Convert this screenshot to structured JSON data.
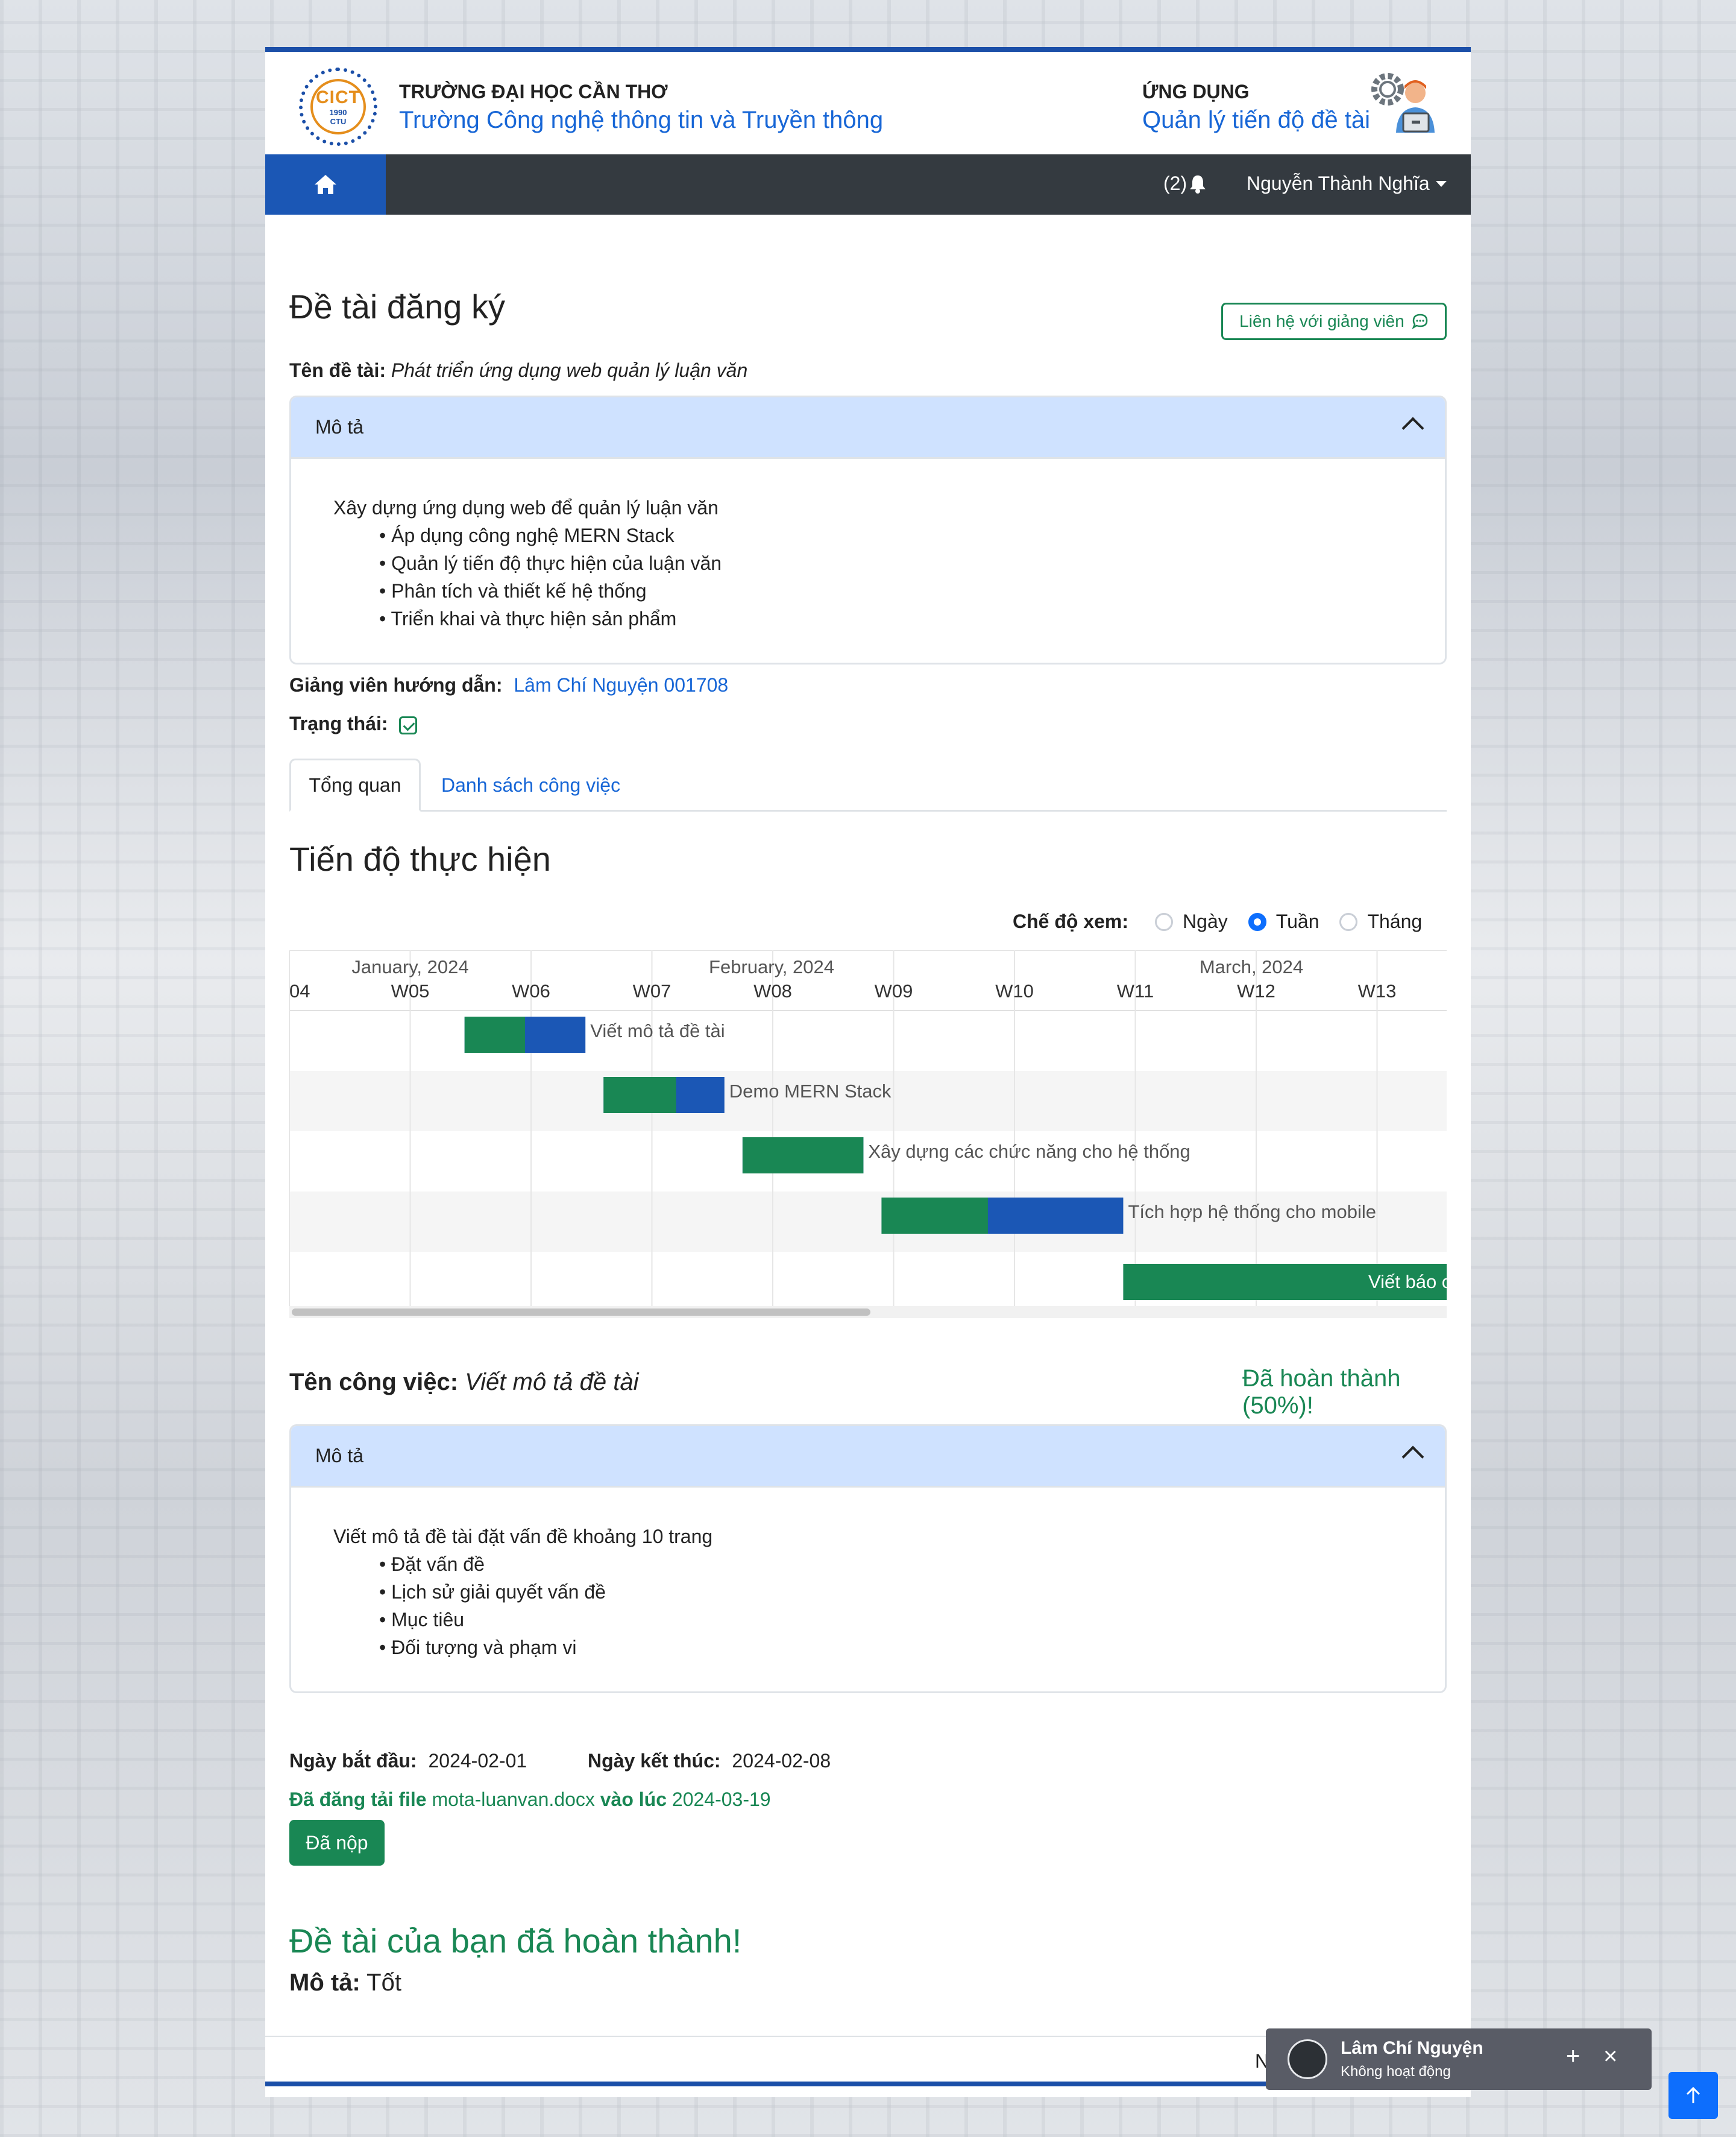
{
  "header": {
    "university": "TRƯỜNG ĐẠI HỌC CẦN THƠ",
    "school": "Trường Công nghệ thông tin và Truyền thông",
    "app_label": "ỨNG DỤNG",
    "app_name": "Quản lý tiến độ đề tài",
    "logo_text": "CICT",
    "logo_year": "1990",
    "logo_sub": "CTU"
  },
  "nav": {
    "notification_count": "(2)",
    "user_name": "Nguyễn Thành Nghĩa"
  },
  "topic": {
    "page_title": "Đề tài đăng ký",
    "contact_button": "Liên hệ với giảng viên",
    "name_label": "Tên đề tài:",
    "name_value": "Phát triển ứng dụng web quản lý luận văn",
    "desc_header": "Mô tả",
    "desc_intro": "Xây dựng ứng dụng web để quản lý luận văn",
    "desc_items": [
      "• Áp dụng công nghệ MERN Stack",
      "• Quản lý tiến độ thực hiện của luận văn",
      "• Phân tích và thiết kế hệ thống",
      "• Triển khai và thực hiện sản phẩm"
    ],
    "supervisor_label": "Giảng viên hướng dẫn:",
    "supervisor_value": "Lâm Chí Nguyện 001708",
    "status_label": "Trạng thái:"
  },
  "tabs": [
    {
      "label": "Tổng quan",
      "active": true
    },
    {
      "label": "Danh sách công việc",
      "active": false
    }
  ],
  "progress": {
    "title": "Tiến độ thực hiện",
    "view_mode_label": "Chế độ xem:",
    "view_modes": [
      "Ngày",
      "Tuần",
      "Tháng"
    ],
    "selected_mode": "Tuần"
  },
  "chart_data": {
    "type": "gantt",
    "months": [
      "January, 2024",
      "February, 2024",
      "March, 2024"
    ],
    "weeks": [
      "04",
      "W05",
      "W06",
      "W07",
      "W08",
      "W09",
      "W10",
      "W11",
      "W12",
      "W13"
    ],
    "tasks": [
      {
        "name": "Viết mô tả đề tài",
        "start_week": 5.45,
        "end_week": 6.45,
        "progress": 0.5
      },
      {
        "name": "Demo MERN Stack",
        "start_week": 6.6,
        "end_week": 7.6,
        "progress": 0.6
      },
      {
        "name": "Xây dựng các chức năng cho hệ thống",
        "start_week": 7.75,
        "end_week": 8.75,
        "progress": 1.0
      },
      {
        "name": "Tích hợp hệ thống cho mobile",
        "start_week": 8.9,
        "end_week": 10.9,
        "progress": 0.44
      },
      {
        "name": "Viết báo c",
        "start_week": 10.9,
        "end_week": 13.6,
        "progress": 1.0
      }
    ],
    "colors": {
      "done": "#198754",
      "remaining": "#1b57b5"
    }
  },
  "task": {
    "name_label": "Tên công việc:",
    "name_value": "Viết mô tả đề tài",
    "status": "Đã hoàn thành (50%)!",
    "desc_header": "Mô tả",
    "desc_intro": "Viết mô tả đề tài đặt vấn đề khoảng 10 trang",
    "desc_items": [
      "• Đặt vấn đề",
      "• Lịch sử giải quyết vấn đề",
      "• Mục tiêu",
      "• Đối tượng và phạm vi"
    ],
    "start_label": "Ngày bắt đầu:",
    "start_value": "2024-02-01",
    "end_label": "Ngày kết thúc:",
    "end_value": "2024-02-08",
    "upload_prefix": "Đã đăng tải file",
    "upload_file": "mota-luanvan.docx",
    "upload_mid": "vào lúc",
    "upload_date": "2024-03-19",
    "submitted_button": "Đã nộp"
  },
  "result": {
    "finished_text": "Đề tài của bạn đã hoàn thành!",
    "desc_label": "Mô tả:",
    "desc_value": "Tốt"
  },
  "footer": {
    "partial_text": "N"
  },
  "chat": {
    "name": "Lâm Chí Nguyện",
    "status": "Không hoạt động"
  }
}
